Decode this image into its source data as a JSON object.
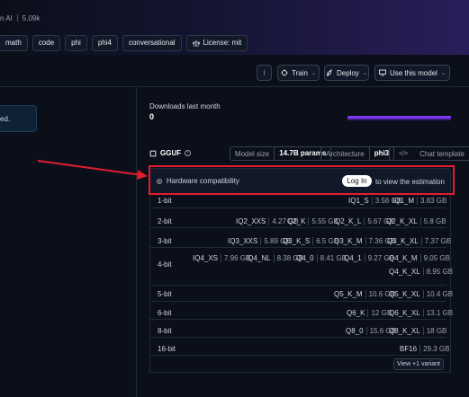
{
  "header": {
    "org_fragment": "n AI",
    "likes": "5.09k",
    "tags": [
      {
        "label": "math"
      },
      {
        "label": "code"
      },
      {
        "label": "phi"
      },
      {
        "label": "phi4"
      },
      {
        "label": "conversational"
      },
      {
        "label": "License: mit",
        "icon": "scale-icon"
      }
    ]
  },
  "actions": {
    "more": "⁝",
    "train": "Train",
    "deploy": "Deploy",
    "use_model": "Use this model"
  },
  "left_notice": "ed.",
  "downloads": {
    "label": "Downloads last month",
    "value": "0"
  },
  "gguf": {
    "label": "GGUF",
    "model_size_label": "Model size",
    "model_size_value": "14.7B params",
    "architecture_label": "Architecture",
    "architecture_value": "phi3",
    "chat_template": "Chat template"
  },
  "hardware": {
    "title": "Hardware compatibility",
    "login": "Log In",
    "to_view": "to view the estimation"
  },
  "quant_rows": [
    {
      "bit": "1-bit",
      "cells": [
        {
          "q": "IQ1_S",
          "s": "3.58 GB"
        },
        {
          "q": "IQ1_M",
          "s": "3.83 GB"
        }
      ]
    },
    {
      "bit": "2-bit",
      "cells": [
        {
          "q": "IQ2_XXS",
          "s": "4.27 GB"
        },
        {
          "q": "Q2_K",
          "s": "5.55 GB"
        },
        {
          "q": "Q2_K_L",
          "s": "5.67 GB"
        },
        {
          "q": "Q2_K_XL",
          "s": "5.8 GB"
        }
      ]
    },
    {
      "bit": "3-bit",
      "cells": [
        {
          "q": "IQ3_XXS",
          "s": "5.89 GB"
        },
        {
          "q": "Q3_K_S",
          "s": "6.5 GB"
        },
        {
          "q": "Q3_K_M",
          "s": "7.36 GB"
        },
        {
          "q": "Q3_K_XL",
          "s": "7.37 GB"
        }
      ]
    },
    {
      "bit": "4-bit",
      "cells": [
        {
          "q": "IQ4_XS",
          "s": "7.96 GB"
        },
        {
          "q": "IQ4_NL",
          "s": "8.38 GB"
        },
        {
          "q": "Q4_0",
          "s": "8.41 GB"
        },
        {
          "q": "Q4_1",
          "s": "9.27 GB"
        },
        {
          "q": "Q4_K_M",
          "s": "9.05 GB"
        },
        {
          "q": "Q4_K_XL",
          "s": "8.95 GB"
        }
      ]
    },
    {
      "bit": "5-bit",
      "cells": [
        {
          "q": "Q5_K_M",
          "s": "10.6 GB"
        },
        {
          "q": "Q5_K_XL",
          "s": "10.4 GB"
        }
      ]
    },
    {
      "bit": "6-bit",
      "cells": [
        {
          "q": "Q6_K",
          "s": "12 GB"
        },
        {
          "q": "Q6_K_XL",
          "s": "13.1 GB"
        }
      ]
    },
    {
      "bit": "8-bit",
      "cells": [
        {
          "q": "Q8_0",
          "s": "15.6 GB"
        },
        {
          "q": "Q8_K_XL",
          "s": "18 GB"
        }
      ]
    },
    {
      "bit": "16-bit",
      "cells": [
        {
          "q": "BF16",
          "s": "29.3 GB"
        }
      ]
    }
  ],
  "view_variant": "View +1 variant",
  "colors": {
    "annotation": "#e11d2e",
    "accent": "#7c3aed",
    "background": "#0b0f19"
  }
}
